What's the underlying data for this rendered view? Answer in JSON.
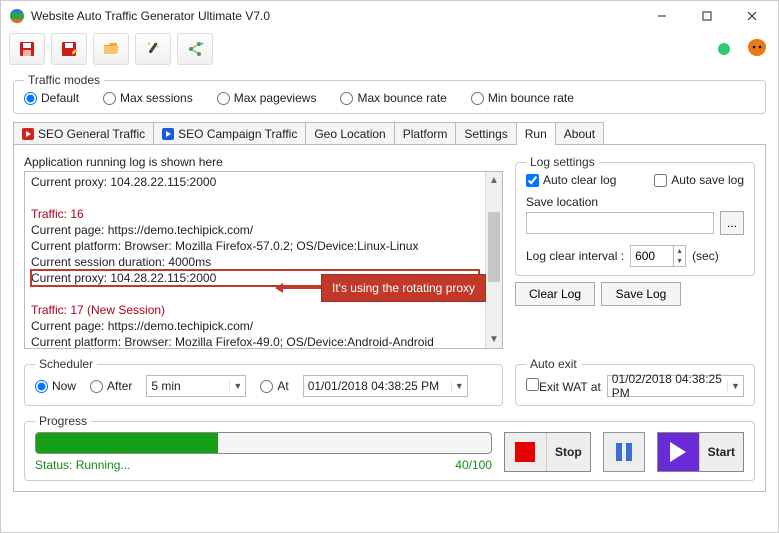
{
  "title": "Website Auto Traffic Generator Ultimate V7.0",
  "trafficModes": {
    "legend": "Traffic modes",
    "options": {
      "default": "Default",
      "maxSessions": "Max sessions",
      "maxPageviews": "Max pageviews",
      "maxBounce": "Max bounce rate",
      "minBounce": "Min bounce rate"
    }
  },
  "tabs": {
    "seoGeneral": "SEO General Traffic",
    "seoCampaign": "SEO Campaign Traffic",
    "geo": "Geo Location",
    "platform": "Platform",
    "settings": "Settings",
    "run": "Run",
    "about": "About"
  },
  "logCaption": "Application running log is shown here",
  "log": {
    "l0": "Current proxy: 104.28.22.115:2000",
    "t16": "Traffic: 16",
    "l1": "Current page: https://demo.techipick.com/",
    "l2": "Current platform: Browser: Mozilla Firefox-57.0.2; OS/Device:Linux-Linux",
    "l3": "Current session duration: 4000ms",
    "l4": "Current proxy: 104.28.22.115:2000",
    "t17": "Traffic: 17 (New Session)",
    "l5": "Current page: https://demo.techipick.com/",
    "l6": "Current platform: Browser: Mozilla Firefox-49.0; OS/Device:Android-Android"
  },
  "logSettings": {
    "legend": "Log settings",
    "autoClear": "Auto clear log",
    "autoSave": "Auto save log",
    "saveLocation": "Save location",
    "browse": "...",
    "intervalLabel": "Log clear interval :",
    "intervalValue": "600",
    "intervalUnit": "(sec)"
  },
  "buttons": {
    "clearLog": "Clear Log",
    "saveLog": "Save Log",
    "stop": "Stop",
    "start": "Start"
  },
  "scheduler": {
    "legend": "Scheduler",
    "now": "Now",
    "after": "After",
    "afterVal": "5 min",
    "at": "At",
    "atVal": "01/01/2018 04:38:25 PM"
  },
  "autoExit": {
    "legend": "Auto exit",
    "label": "Exit WAT at",
    "value": "01/02/2018 04:38:25 PM"
  },
  "progress": {
    "legend": "Progress",
    "status": "Status: Running...",
    "count": "40/100"
  },
  "annotation": "It's using the rotating proxy"
}
